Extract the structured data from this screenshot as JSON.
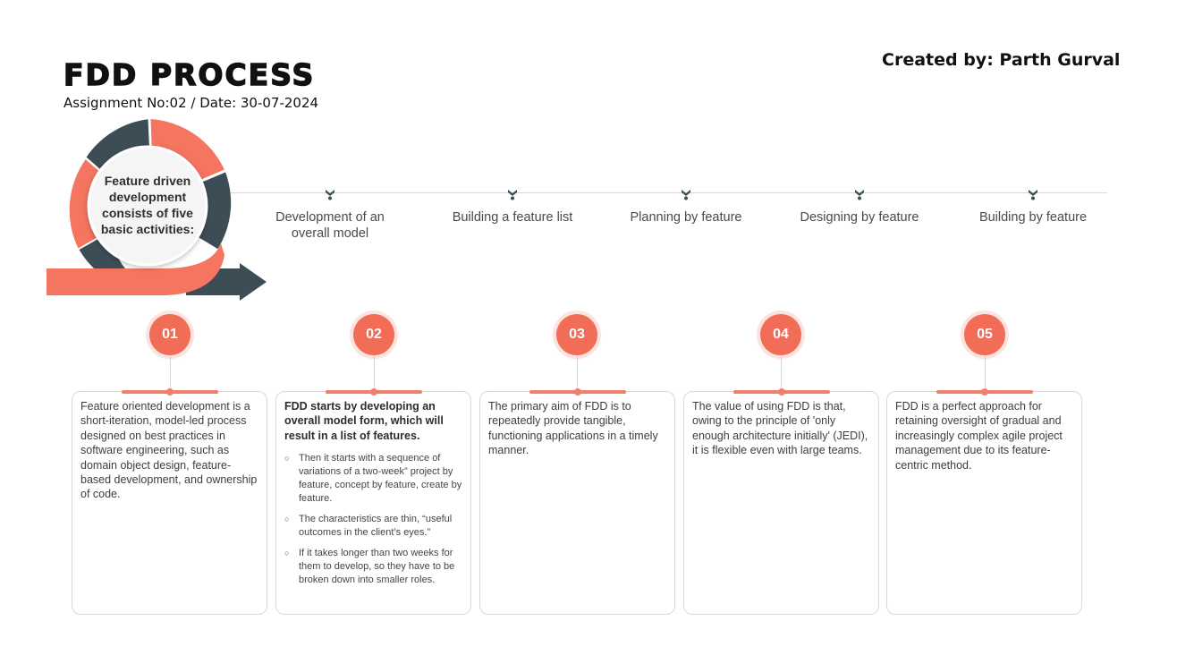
{
  "header": {
    "title": "FDD PROCESS",
    "subtitle": "Assignment No:02 / Date: 30-07-2024",
    "credit": "Created by: Parth Gurval"
  },
  "wheel": {
    "center_text": "Feature driven development consists of five basic activities:",
    "colors": {
      "coral": "#f47560",
      "slate": "#3d4d56"
    }
  },
  "activities": [
    {
      "label": "Development of an overall model"
    },
    {
      "label": "Building a feature list"
    },
    {
      "label": "Planning by feature"
    },
    {
      "label": "Designing by feature"
    },
    {
      "label": "Building by feature"
    }
  ],
  "steps": [
    {
      "number": "01",
      "text": "Feature oriented development is a short-iteration, model-led process designed on best practices in software engineering, such as domain object design, feature-based development, and ownership of code."
    },
    {
      "number": "02",
      "lead": "FDD starts by developing an overall model form, which will result in a list of features.",
      "bullets": [
        "Then it starts with a sequence of variations of a two-week” project by feature, concept by feature, create by feature.",
        "The characteristics are thin, “useful outcomes in the client’s eyes.”",
        "If it takes longer than two weeks for them to develop, so they have to be broken down into smaller roles."
      ]
    },
    {
      "number": "03",
      "text": "The primary aim of FDD is to repeatedly provide tangible, functioning applications in a timely manner."
    },
    {
      "number": "04",
      "text": "The value of using FDD is that, owing to the principle of 'only enough architecture initially' (JEDI), it is flexible even with large teams."
    },
    {
      "number": "05",
      "text": "FDD is a perfect approach for retaining oversight of gradual and increasingly complex agile project management due to its feature-centric method."
    }
  ]
}
